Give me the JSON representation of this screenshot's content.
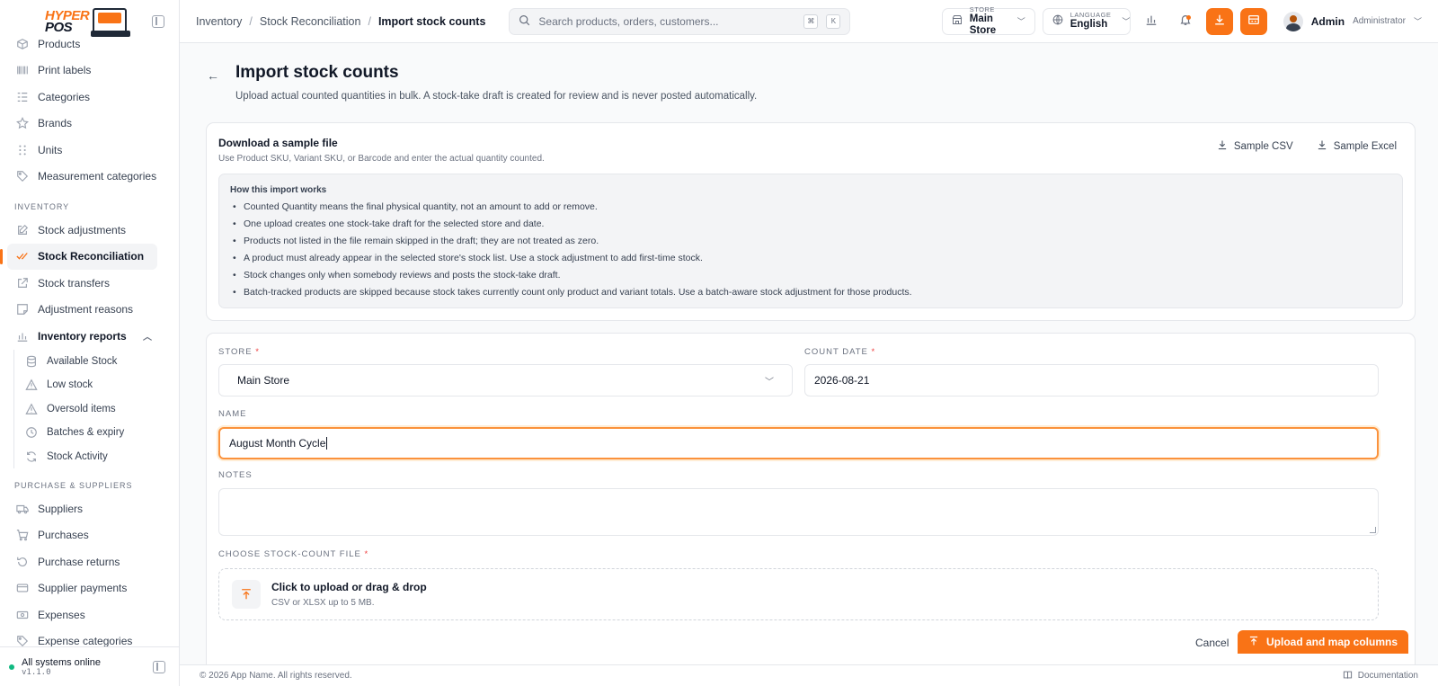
{
  "brand": {
    "line1": "HYPER",
    "line2": "POS"
  },
  "sidebar": {
    "top_items": [
      {
        "label": "Products",
        "icon": "box-icon"
      },
      {
        "label": "Print labels",
        "icon": "barcode-icon"
      },
      {
        "label": "Categories",
        "icon": "list-icon"
      },
      {
        "label": "Brands",
        "icon": "star-icon"
      },
      {
        "label": "Units",
        "icon": "grid-dots-icon"
      },
      {
        "label": "Measurement categories",
        "icon": "tag-icon"
      }
    ],
    "inventory_section": "INVENTORY",
    "inventory_items": [
      {
        "label": "Stock adjustments",
        "icon": "edit-icon"
      },
      {
        "label": "Stock Reconciliation",
        "icon": "check-double-icon",
        "active": true
      },
      {
        "label": "Stock transfers",
        "icon": "external-link-icon"
      },
      {
        "label": "Adjustment reasons",
        "icon": "note-icon"
      }
    ],
    "reports_group": "Inventory reports",
    "reports_items": [
      {
        "label": "Available Stock",
        "icon": "database-icon"
      },
      {
        "label": "Low stock",
        "icon": "warning-icon"
      },
      {
        "label": "Oversold items",
        "icon": "warning-icon"
      },
      {
        "label": "Batches & expiry",
        "icon": "clock-icon"
      },
      {
        "label": "Stock Activity",
        "icon": "refresh-icon"
      }
    ],
    "purchase_section": "PURCHASE & SUPPLIERS",
    "purchase_items": [
      {
        "label": "Suppliers",
        "icon": "truck-icon"
      },
      {
        "label": "Purchases",
        "icon": "cart-icon"
      },
      {
        "label": "Purchase returns",
        "icon": "return-icon"
      },
      {
        "label": "Supplier payments",
        "icon": "credit-card-icon"
      },
      {
        "label": "Expenses",
        "icon": "cash-icon"
      },
      {
        "label": "Expense categories",
        "icon": "tag-icon"
      }
    ],
    "status": "All systems online",
    "version": "v1.1.0"
  },
  "header": {
    "breadcrumb": [
      "Inventory",
      "Stock Reconciliation",
      "Import stock counts"
    ],
    "search_placeholder": "Search products, orders, customers...",
    "kbd": [
      "⌘",
      "K"
    ],
    "store_caption": "STORE",
    "store_value": "Main Store",
    "language_caption": "LANGUAGE",
    "language_value": "English",
    "user_name": "Admin",
    "user_role": "Administrator"
  },
  "page": {
    "title": "Import stock counts",
    "subtitle": "Upload actual counted quantities in bulk. A stock-take draft is created for review and is never posted automatically."
  },
  "sample": {
    "title": "Download a sample file",
    "subtitle": "Use Product SKU, Variant SKU, or Barcode and enter the actual quantity counted.",
    "csv_label": "Sample CSV",
    "excel_label": "Sample Excel",
    "howto_title": "How this import works",
    "howto": [
      "Counted Quantity means the final physical quantity, not an amount to add or remove.",
      "One upload creates one stock-take draft for the selected store and date.",
      "Products not listed in the file remain skipped in the draft; they are not treated as zero.",
      "A product must already appear in the selected store's stock list. Use a stock adjustment to add first-time stock.",
      "Stock changes only when somebody reviews and posts the stock-take draft.",
      "Batch-tracked products are skipped because stock takes currently count only product and variant totals. Use a batch-aware stock adjustment for those products."
    ]
  },
  "form": {
    "store_label": "STORE",
    "store_value": "Main Store",
    "date_label": "COUNT DATE",
    "date_value": "2026-08-21",
    "name_label": "NAME",
    "name_value": "August Month Cycle",
    "notes_label": "NOTES",
    "notes_value": "",
    "file_label": "CHOOSE STOCK-COUNT FILE",
    "required_mark": "*",
    "upload_title": "Click to upload or drag & drop",
    "upload_sub": "CSV or XLSX up to 5 MB.",
    "cancel_label": "Cancel",
    "submit_label": "Upload and map columns"
  },
  "footer": {
    "copyright": "© 2026 App Name. All rights reserved.",
    "doc_label": "Documentation"
  },
  "colors": {
    "accent": "#f97316",
    "online": "#10b981"
  }
}
